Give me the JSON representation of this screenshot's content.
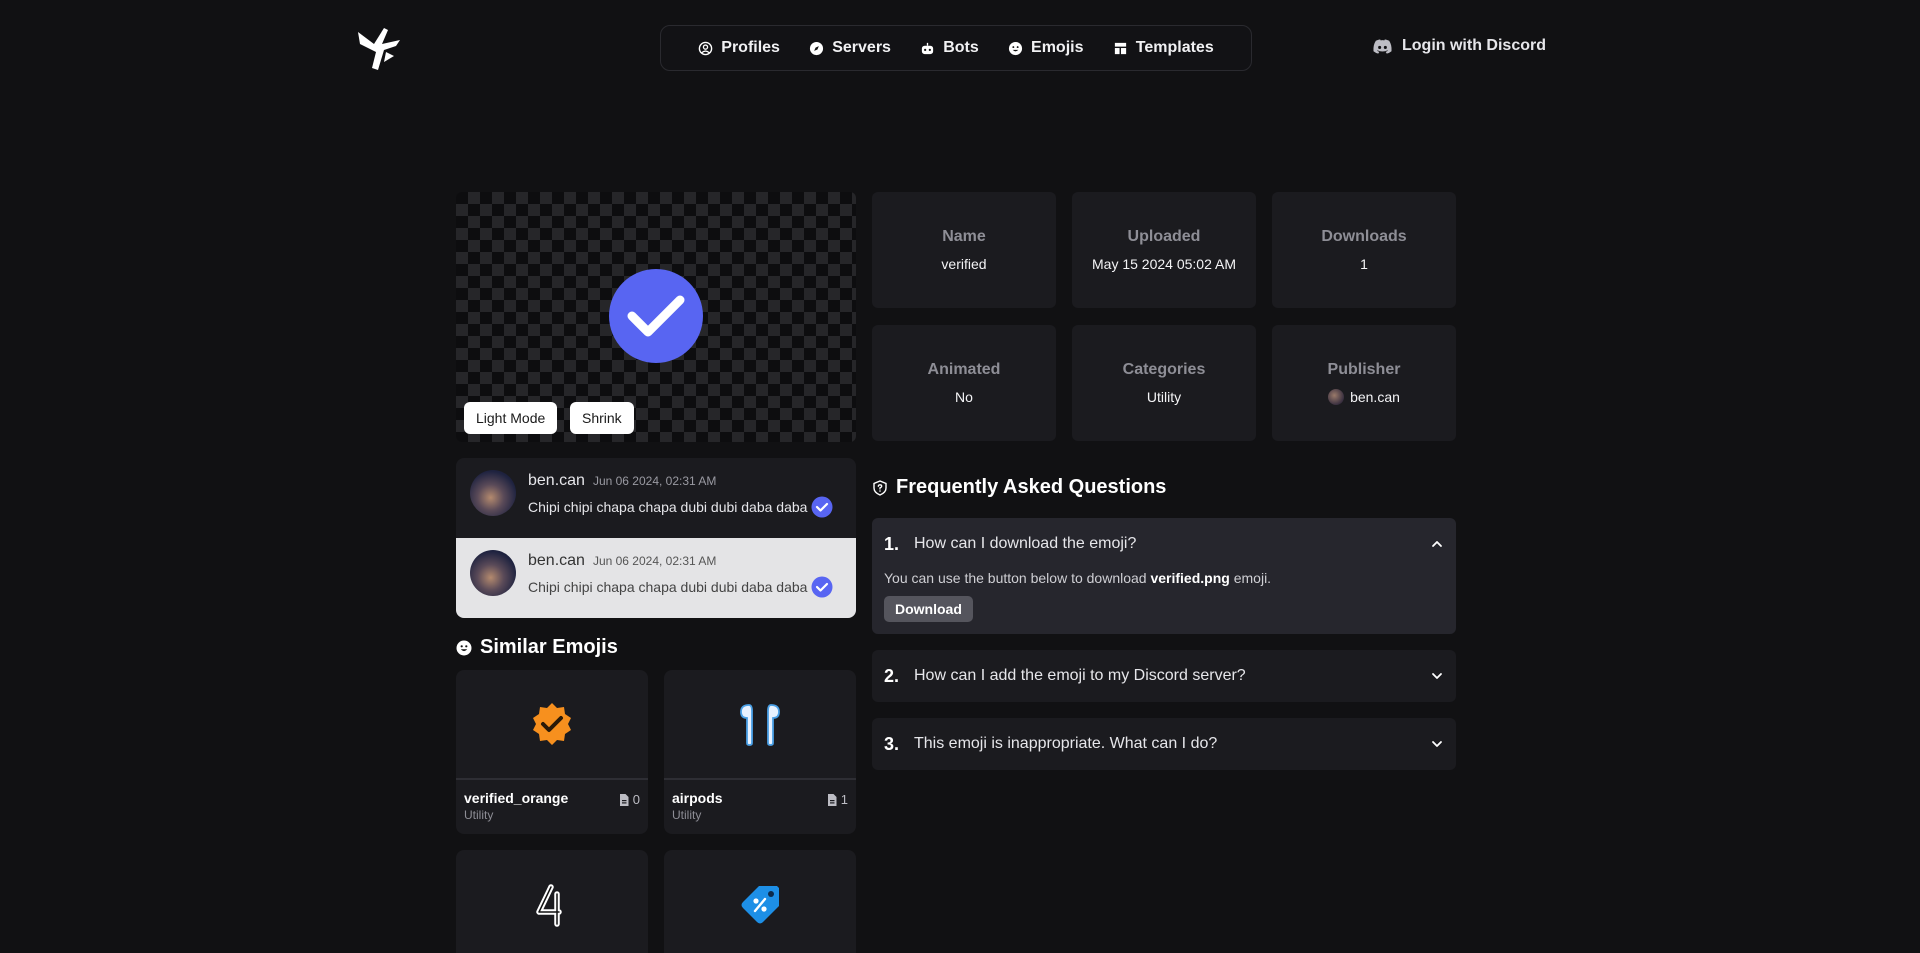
{
  "nav": {
    "items": [
      {
        "label": "Profiles",
        "icon": "user-circle-icon"
      },
      {
        "label": "Servers",
        "icon": "compass-icon"
      },
      {
        "label": "Bots",
        "icon": "robot-icon"
      },
      {
        "label": "Emojis",
        "icon": "smiley-icon"
      },
      {
        "label": "Templates",
        "icon": "layout-icon"
      }
    ],
    "login_label": "Login with Discord"
  },
  "preview": {
    "light_mode_label": "Light Mode",
    "shrink_label": "Shrink"
  },
  "info": {
    "name": {
      "label": "Name",
      "value": "verified"
    },
    "uploaded": {
      "label": "Uploaded",
      "value": "May 15 2024 05:02 AM"
    },
    "downloads": {
      "label": "Downloads",
      "value": "1"
    },
    "animated": {
      "label": "Animated",
      "value": "No"
    },
    "categories": {
      "label": "Categories",
      "value": "Utility"
    },
    "publisher": {
      "label": "Publisher",
      "value": "ben.can"
    }
  },
  "messages": [
    {
      "author": "ben.can",
      "time": "Jun 06 2024, 02:31 AM",
      "text": "Chipi chipi chapa chapa dubi dubi daba daba"
    },
    {
      "author": "ben.can",
      "time": "Jun 06 2024, 02:31 AM",
      "text": "Chipi chipi chapa chapa dubi dubi daba daba"
    }
  ],
  "similar": {
    "title": "Similar Emojis",
    "items": [
      {
        "name": "verified_orange",
        "category": "Utility",
        "downloads": "0"
      },
      {
        "name": "airpods",
        "category": "Utility",
        "downloads": "1"
      }
    ]
  },
  "faq": {
    "title": "Frequently Asked Questions",
    "items": [
      {
        "num": "1.",
        "question": "How can I download the emoji?"
      },
      {
        "num": "2.",
        "question": "How can I add the emoji to my Discord server?"
      },
      {
        "num": "3.",
        "question": "This emoji is inappropriate. What can I do?"
      }
    ],
    "answer_prefix": "You can use the button below to download",
    "answer_file": "verified.png",
    "answer_suffix": "emoji.",
    "download_label": "Download"
  },
  "colors": {
    "accent": "#5865f2",
    "background": "#111113",
    "card": "#1b1b1f"
  }
}
